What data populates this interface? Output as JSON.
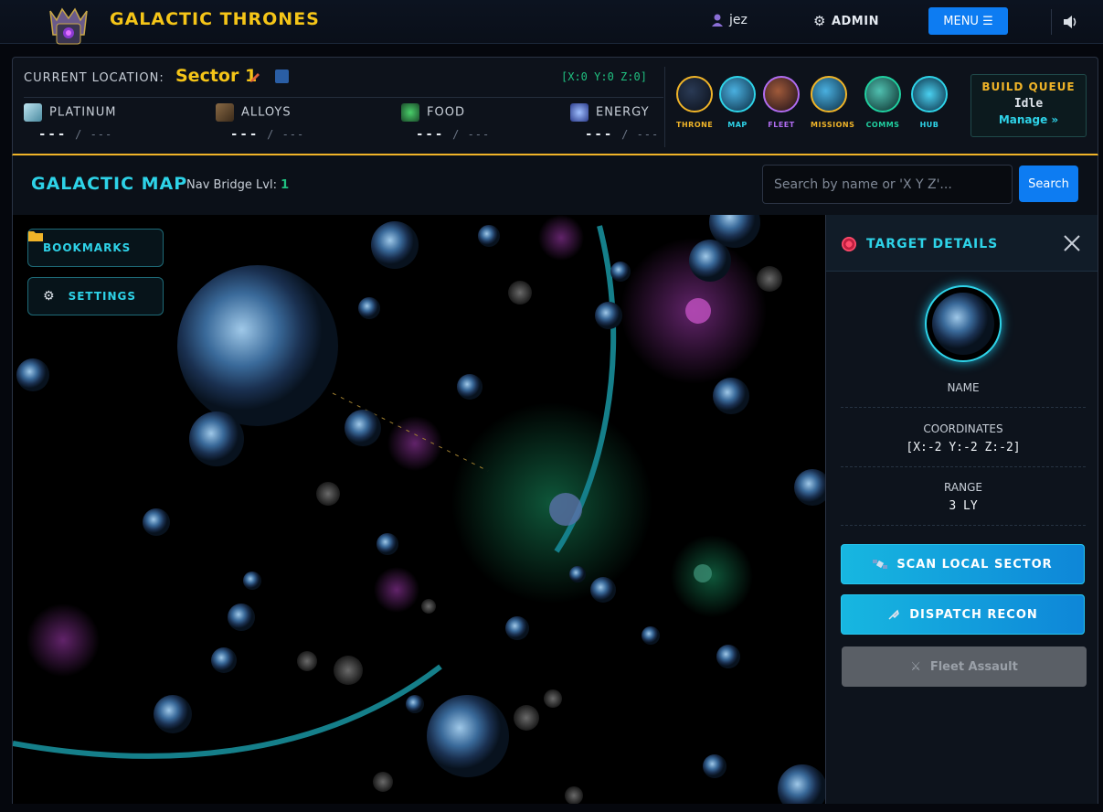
{
  "header": {
    "title": "GALACTIC THRONES",
    "user": "jez",
    "admin_label": "ADMIN",
    "menu_label": "MENU ☰"
  },
  "hud": {
    "location_label": "CURRENT LOCATION:",
    "location_value": "Sector 1",
    "coords": "[X:0 Y:0 Z:0]",
    "resources": [
      {
        "name": "PLATINUM",
        "current": "---",
        "max": "/ ---"
      },
      {
        "name": "ALLOYS",
        "current": "---",
        "max": "/ ---"
      },
      {
        "name": "FOOD",
        "current": "---",
        "max": "/ ---"
      },
      {
        "name": "ENERGY",
        "current": "---",
        "max": "/ ---"
      }
    ],
    "nav": [
      {
        "label": "THRONE",
        "color": "#f0b428"
      },
      {
        "label": "MAP",
        "color": "#2ed3e8"
      },
      {
        "label": "FLEET",
        "color": "#b06cf0"
      },
      {
        "label": "MISSIONS",
        "color": "#f0b428"
      },
      {
        "label": "COMMS",
        "color": "#20d0a0"
      },
      {
        "label": "HUB",
        "color": "#2ed3e8"
      }
    ],
    "build_queue": {
      "title": "BUILD QUEUE",
      "status": "Idle",
      "manage": "Manage »"
    }
  },
  "map_header": {
    "title": "GALACTIC MAP",
    "nav_bridge_label": "Nav Bridge Lvl:",
    "nav_bridge_level": "1",
    "search_placeholder": "Search by name or 'X Y Z'...",
    "search_button": "Search"
  },
  "map": {
    "bookmarks_label": "BOOKMARKS",
    "settings_label": "SETTINGS"
  },
  "target": {
    "title": "TARGET DETAILS",
    "name_label": "NAME",
    "coords_label": "COORDINATES",
    "coords_value": "[X:-2 Y:-2 Z:-2]",
    "range_label": "RANGE",
    "range_value": "3 LY",
    "scan_label": "SCAN LOCAL SECTOR",
    "recon_label": "DISPATCH RECON",
    "assault_label": "Fleet Assault"
  }
}
